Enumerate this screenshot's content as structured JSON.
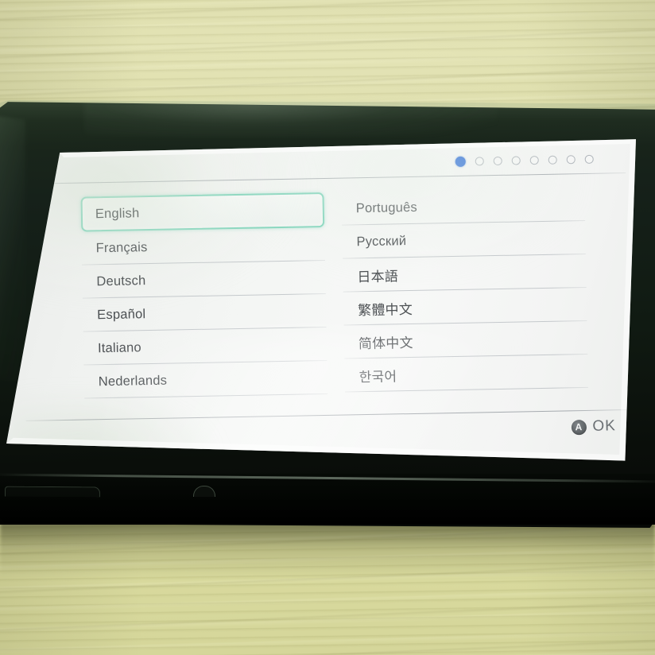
{
  "scene": {
    "description": "Nintendo Switch console on a light wood table showing the language selection setup screen",
    "table_color": "#d8d9a0",
    "bezel_color": "#101a12"
  },
  "screen": {
    "background_color": "#f4f6f4",
    "accent_selection_color": "#84d6bd",
    "page_indicator": {
      "total": 8,
      "active_index": 0,
      "active_color": "#2f6fd8",
      "inactive_color": "#ffffff"
    },
    "languages": {
      "left_column": [
        {
          "label": "English",
          "selected": true
        },
        {
          "label": "Français",
          "selected": false
        },
        {
          "label": "Deutsch",
          "selected": false
        },
        {
          "label": "Español",
          "selected": false
        },
        {
          "label": "Italiano",
          "selected": false
        },
        {
          "label": "Nederlands",
          "selected": false
        }
      ],
      "right_column": [
        {
          "label": "Português",
          "selected": false
        },
        {
          "label": "Русский",
          "selected": false
        },
        {
          "label": "日本語",
          "selected": false,
          "cjk": true
        },
        {
          "label": "繁體中文",
          "selected": false,
          "cjk": true
        },
        {
          "label": "简体中文",
          "selected": false,
          "cjk": true
        },
        {
          "label": "한국어",
          "selected": false,
          "cjk": true
        }
      ]
    },
    "footer": {
      "button_glyph": "A",
      "button_label": "OK"
    }
  }
}
